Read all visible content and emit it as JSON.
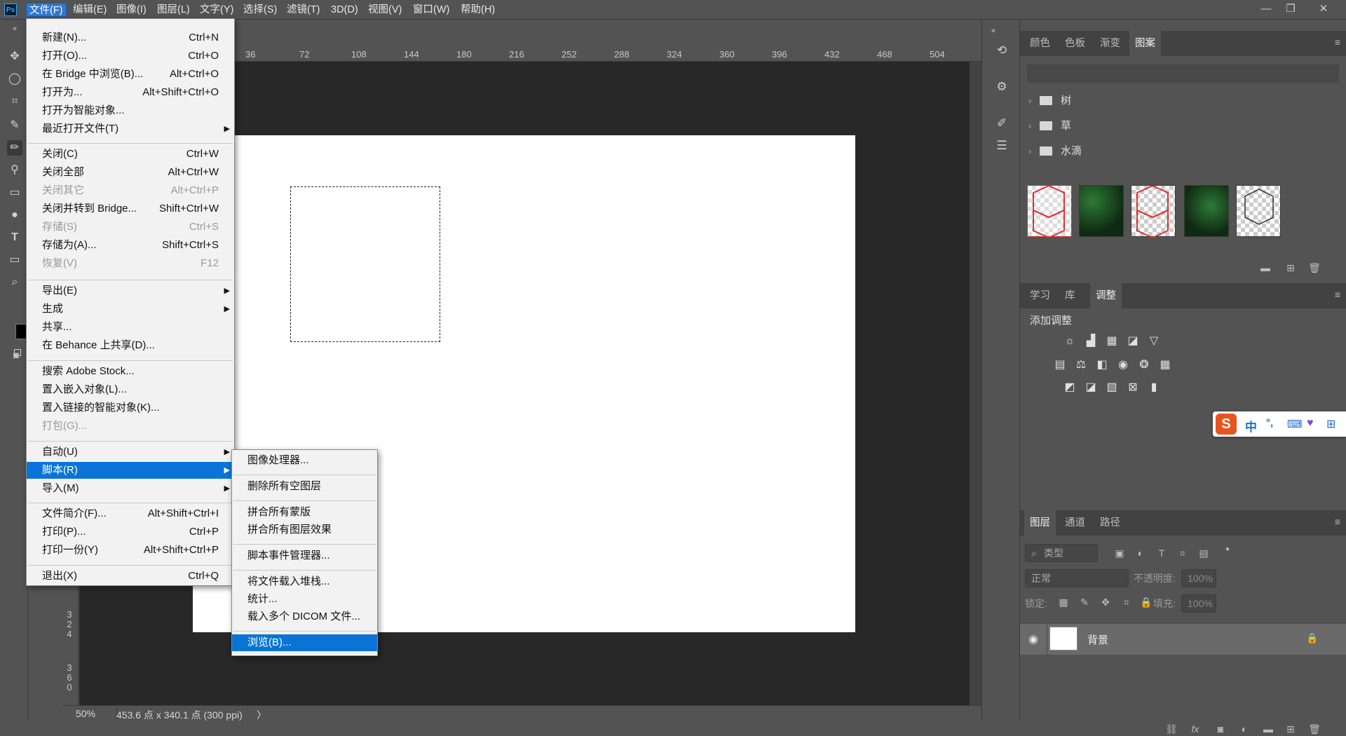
{
  "app": {
    "logo": "Ps"
  },
  "menubar": {
    "items": [
      "文件(F)",
      "编辑(E)",
      "图像(I)",
      "图层(L)",
      "文字(Y)",
      "选择(S)",
      "滤镜(T)",
      "3D(D)",
      "视图(V)",
      "窗口(W)",
      "帮助(H)"
    ],
    "active": "文件(F)"
  },
  "window_controls": {
    "minimize": "—",
    "restore": "❐",
    "close": "✕"
  },
  "file_menu": {
    "items": [
      {
        "label": "新建(N)...",
        "shortcut": "Ctrl+N"
      },
      {
        "label": "打开(O)...",
        "shortcut": "Ctrl+O"
      },
      {
        "label": "在 Bridge 中浏览(B)...",
        "shortcut": "Alt+Ctrl+O"
      },
      {
        "label": "打开为...",
        "shortcut": "Alt+Shift+Ctrl+O"
      },
      {
        "label": "打开为智能对象...",
        "shortcut": ""
      },
      {
        "label": "最近打开文件(T)",
        "shortcut": "",
        "submenu": true
      },
      {
        "label": "关闭(C)",
        "shortcut": "Ctrl+W"
      },
      {
        "label": "关闭全部",
        "shortcut": "Alt+Ctrl+W"
      },
      {
        "label": "关闭其它",
        "shortcut": "Alt+Ctrl+P",
        "disabled": true
      },
      {
        "label": "关闭并转到 Bridge...",
        "shortcut": "Shift+Ctrl+W"
      },
      {
        "label": "存储(S)",
        "shortcut": "Ctrl+S",
        "disabled": true
      },
      {
        "label": "存储为(A)...",
        "shortcut": "Shift+Ctrl+S"
      },
      {
        "label": "恢复(V)",
        "shortcut": "F12",
        "disabled": true
      },
      {
        "label": "导出(E)",
        "shortcut": "",
        "submenu": true
      },
      {
        "label": "生成",
        "shortcut": "",
        "submenu": true
      },
      {
        "label": "共享...",
        "shortcut": ""
      },
      {
        "label": "在 Behance 上共享(D)...",
        "shortcut": ""
      },
      {
        "label": "搜索 Adobe Stock...",
        "shortcut": ""
      },
      {
        "label": "置入嵌入对象(L)...",
        "shortcut": ""
      },
      {
        "label": "置入链接的智能对象(K)...",
        "shortcut": ""
      },
      {
        "label": "打包(G)...",
        "shortcut": "",
        "disabled": true
      },
      {
        "label": "自动(U)",
        "shortcut": "",
        "submenu": true
      },
      {
        "label": "脚本(R)",
        "shortcut": "",
        "submenu": true,
        "active": true
      },
      {
        "label": "导入(M)",
        "shortcut": "",
        "submenu": true
      },
      {
        "label": "文件简介(F)...",
        "shortcut": "Alt+Shift+Ctrl+I"
      },
      {
        "label": "打印(P)...",
        "shortcut": "Ctrl+P"
      },
      {
        "label": "打印一份(Y)",
        "shortcut": "Alt+Shift+Ctrl+P"
      },
      {
        "label": "退出(X)",
        "shortcut": "Ctrl+Q"
      }
    ]
  },
  "scripts_submenu": {
    "items": [
      {
        "label": "图像处理器..."
      },
      {
        "label": "删除所有空图层"
      },
      {
        "label": "拼合所有蒙版"
      },
      {
        "label": "拼合所有图层效果"
      },
      {
        "label": "脚本事件管理器..."
      },
      {
        "label": "将文件载入堆栈..."
      },
      {
        "label": "统计..."
      },
      {
        "label": "载入多个 DICOM 文件..."
      },
      {
        "label": "浏览(B)...",
        "active": true
      }
    ]
  },
  "ruler": {
    "top_ticks": [
      "36",
      "72",
      "108",
      "144",
      "180",
      "216",
      "252",
      "288",
      "324",
      "360",
      "396",
      "432",
      "468",
      "504"
    ],
    "left_ticks": [
      "3",
      "2",
      "4",
      "3",
      "6",
      "0"
    ]
  },
  "status": {
    "zoom": "50%",
    "doc_info": "453.6 点 x 340.1 点 (300 ppi)",
    "arrow": "〉"
  },
  "patterns_panel": {
    "tabs": [
      "颜色",
      "色板",
      "渐变",
      "图案"
    ],
    "active_tab": "图案",
    "folders": [
      "树",
      "草",
      "水滴"
    ]
  },
  "adjustments_panel": {
    "tabs": [
      "学习",
      "库",
      "调整"
    ],
    "active_tab": "调整",
    "title": "添加调整"
  },
  "layers_panel": {
    "tabs": [
      "图层",
      "通道",
      "路径"
    ],
    "active_tab": "图层",
    "filter_placeholder": "类型",
    "blend_mode": "正常",
    "opacity_label": "不透明度:",
    "opacity_value": "100%",
    "lock_label": "锁定:",
    "fill_label": "填充:",
    "fill_value": "100%",
    "layers": [
      {
        "name": "背景",
        "visible": true,
        "locked": true
      }
    ]
  },
  "ime": {
    "logo": "S",
    "lang": "中",
    "punct": "°,"
  }
}
